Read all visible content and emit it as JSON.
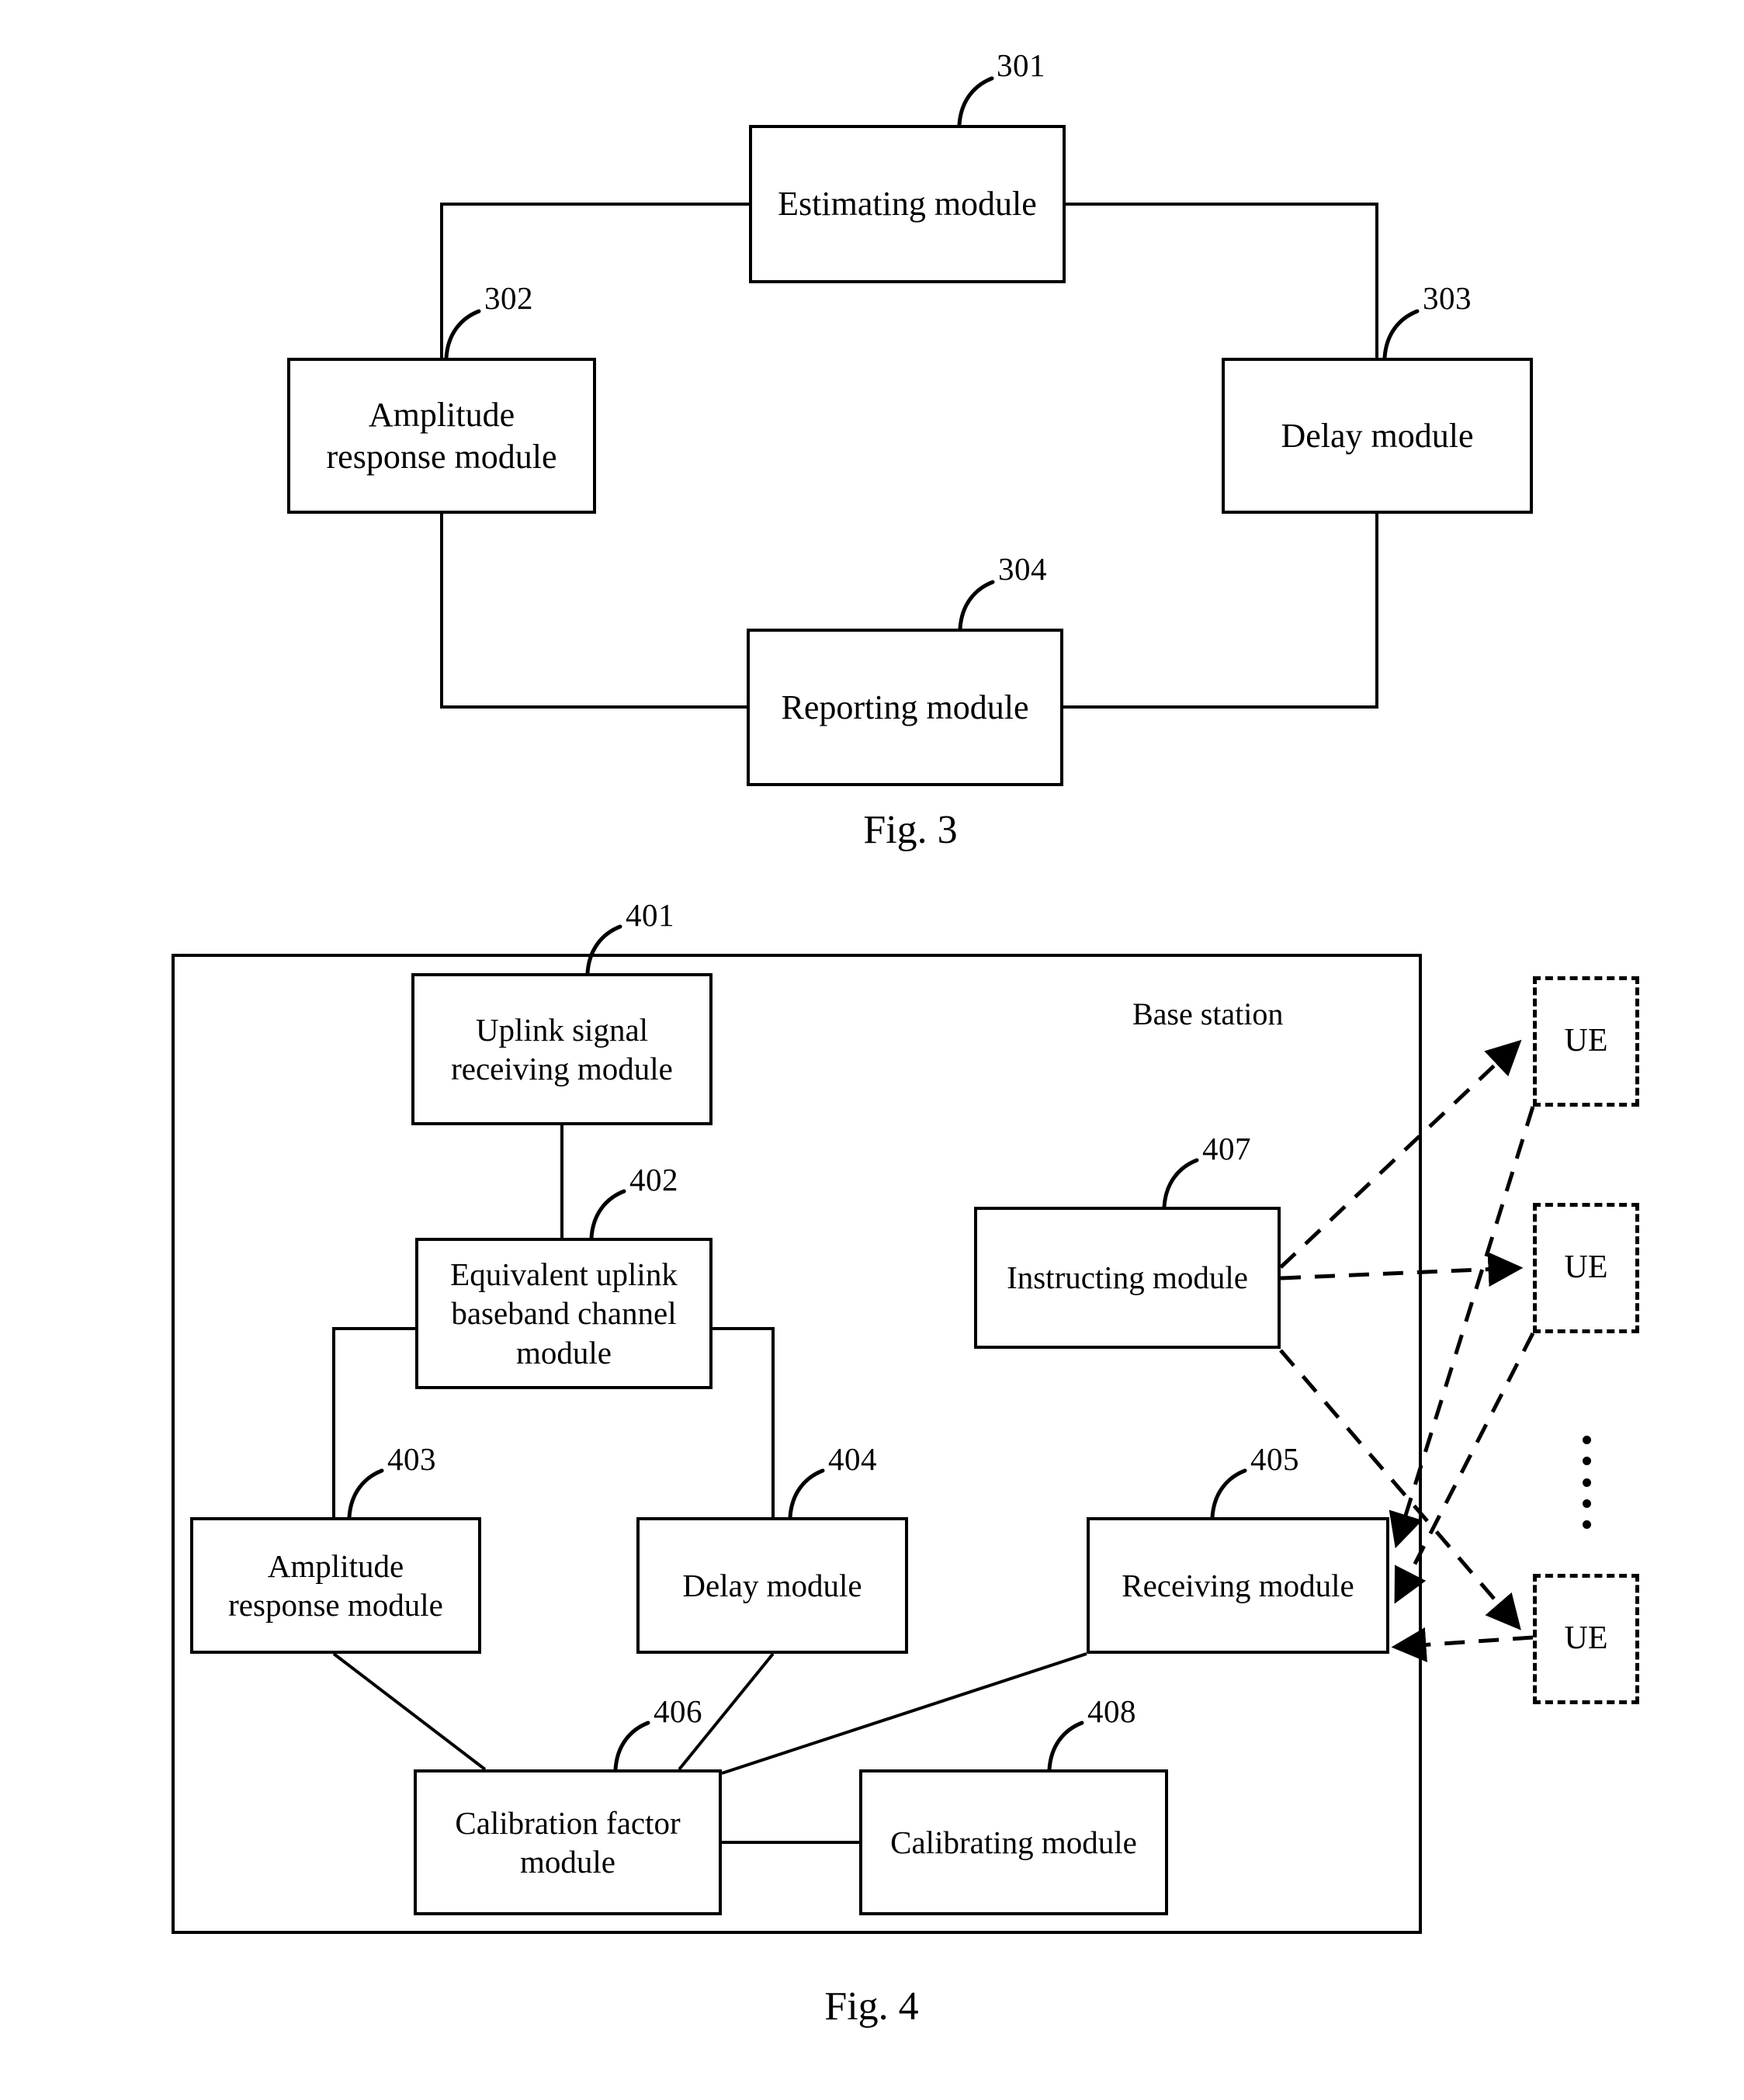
{
  "figure3": {
    "caption": "Fig. 3",
    "boxes": [
      {
        "id": "estimating",
        "label": "Estimating module",
        "ref": "301"
      },
      {
        "id": "amplitude",
        "label": "Amplitude\nresponse module",
        "ref": "302"
      },
      {
        "id": "delay",
        "label": "Delay module",
        "ref": "303"
      },
      {
        "id": "reporting",
        "label": "Reporting module",
        "ref": "304"
      }
    ],
    "labels": {
      "estimating": "Estimating module",
      "amplitude_line1": "Amplitude",
      "amplitude_line2": "response module",
      "delay": "Delay module",
      "reporting": "Reporting module"
    },
    "refs": {
      "estimating": "301",
      "amplitude": "302",
      "delay": "303",
      "reporting": "304"
    }
  },
  "figure4": {
    "caption": "Fig. 4",
    "container_label": "Base station",
    "labels": {
      "uplink_line1": "Uplink signal",
      "uplink_line2": "receiving module",
      "equivalent_line1": "Equivalent uplink",
      "equivalent_line2": "baseband channel",
      "equivalent_line3": "module",
      "amplitude_line1": "Amplitude",
      "amplitude_line2": "response module",
      "delay": "Delay module",
      "receiving": "Receiving module",
      "calibration_factor_line1": "Calibration factor",
      "calibration_factor_line2": "module",
      "calibrating": "Calibrating module",
      "instructing": "Instructing module",
      "ue1": "UE",
      "ue2": "UE",
      "ue3": "UE"
    },
    "refs": {
      "uplink": "401",
      "equivalent": "402",
      "amplitude": "403",
      "delay": "404",
      "receiving": "405",
      "calibration_factor": "406",
      "instructing": "407",
      "calibrating": "408"
    }
  },
  "colors": {
    "stroke": "#000000",
    "background": "#ffffff"
  }
}
